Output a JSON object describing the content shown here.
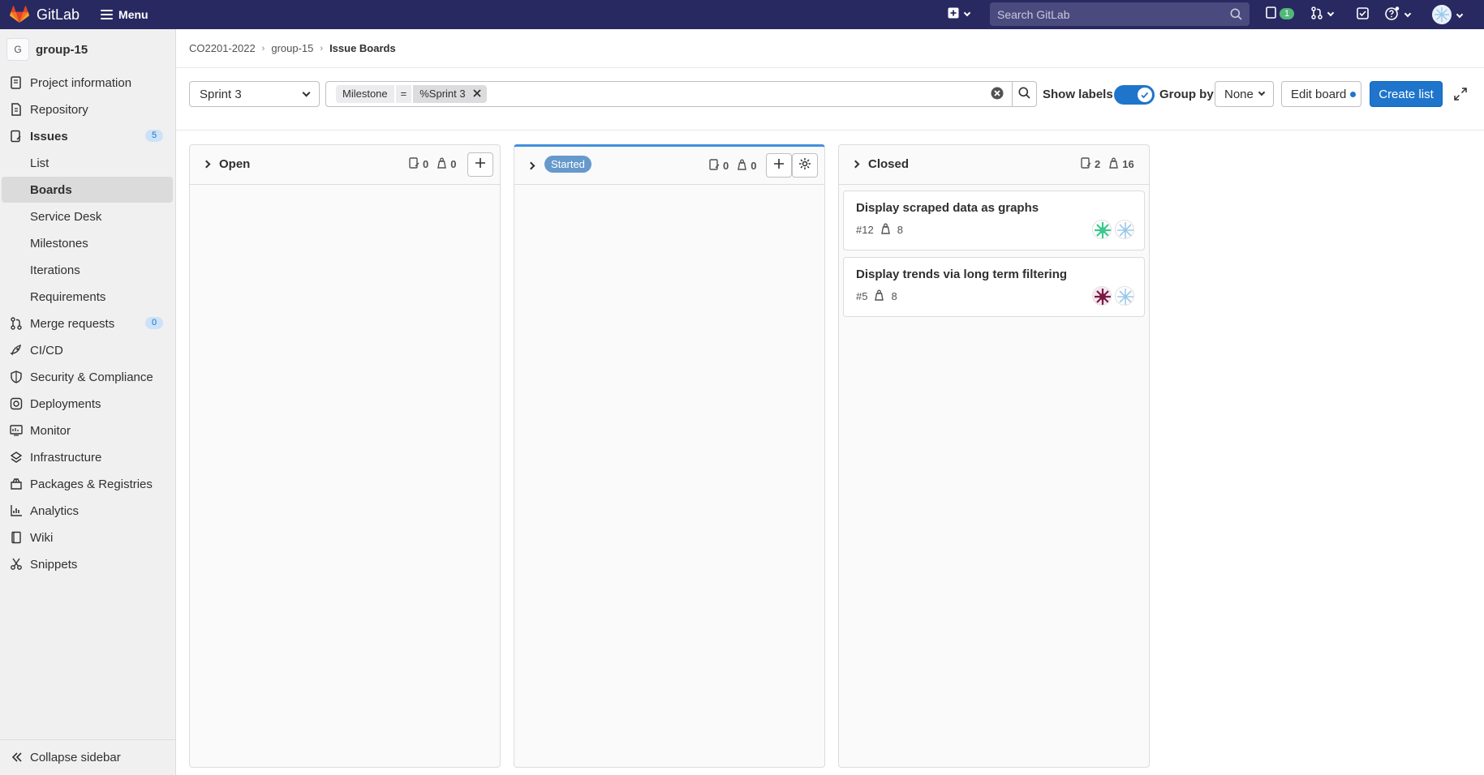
{
  "topbar": {
    "brand": "GitLab",
    "menu_label": "Menu",
    "search_placeholder": "Search GitLab",
    "issues_count": "1"
  },
  "sidebar": {
    "group_initial": "G",
    "group_name": "group-15",
    "items": [
      {
        "label": "Project information",
        "icon": "project-icon"
      },
      {
        "label": "Repository",
        "icon": "repository-icon"
      },
      {
        "label": "Issues",
        "icon": "issues-icon",
        "count": "5"
      },
      {
        "label": "Merge requests",
        "icon": "merge-request-icon",
        "count": "0"
      },
      {
        "label": "CI/CD",
        "icon": "rocket-icon"
      },
      {
        "label": "Security & Compliance",
        "icon": "shield-icon"
      },
      {
        "label": "Deployments",
        "icon": "deployments-icon"
      },
      {
        "label": "Monitor",
        "icon": "monitor-icon"
      },
      {
        "label": "Infrastructure",
        "icon": "cloud-icon"
      },
      {
        "label": "Packages & Registries",
        "icon": "package-icon"
      },
      {
        "label": "Analytics",
        "icon": "chart-icon"
      },
      {
        "label": "Wiki",
        "icon": "book-icon"
      },
      {
        "label": "Snippets",
        "icon": "scissors-icon"
      }
    ],
    "issues_sub": [
      "List",
      "Boards",
      "Service Desk",
      "Milestones",
      "Iterations",
      "Requirements"
    ],
    "collapse_label": "Collapse sidebar"
  },
  "breadcrumb": [
    "CO2201-2022",
    "group-15",
    "Issue Boards"
  ],
  "filters": {
    "board": "Sprint 3",
    "token_key": "Milestone",
    "token_op": "=",
    "token_value": "%Sprint 3",
    "show_labels": "Show labels",
    "show_labels_on": true,
    "group_by_label": "Group by",
    "group_by_value": "None",
    "edit_board": "Edit board",
    "create_list": "Create list"
  },
  "lists": [
    {
      "title": "Open",
      "issues": "0",
      "weight": "0",
      "cards": []
    },
    {
      "title": "Started",
      "issues": "0",
      "weight": "0",
      "label_color": "#6699cc",
      "cards": []
    },
    {
      "title": "Closed",
      "issues": "2",
      "weight": "16",
      "cards": [
        {
          "title": "Display scraped data as graphs",
          "number": "#12",
          "weight": "8"
        },
        {
          "title": "Display trends via long term filtering",
          "number": "#5",
          "weight": "8"
        }
      ]
    }
  ],
  "colors": {
    "navbar": "#292961",
    "primary": "#1f75cb",
    "started_label": "#6699cc"
  }
}
